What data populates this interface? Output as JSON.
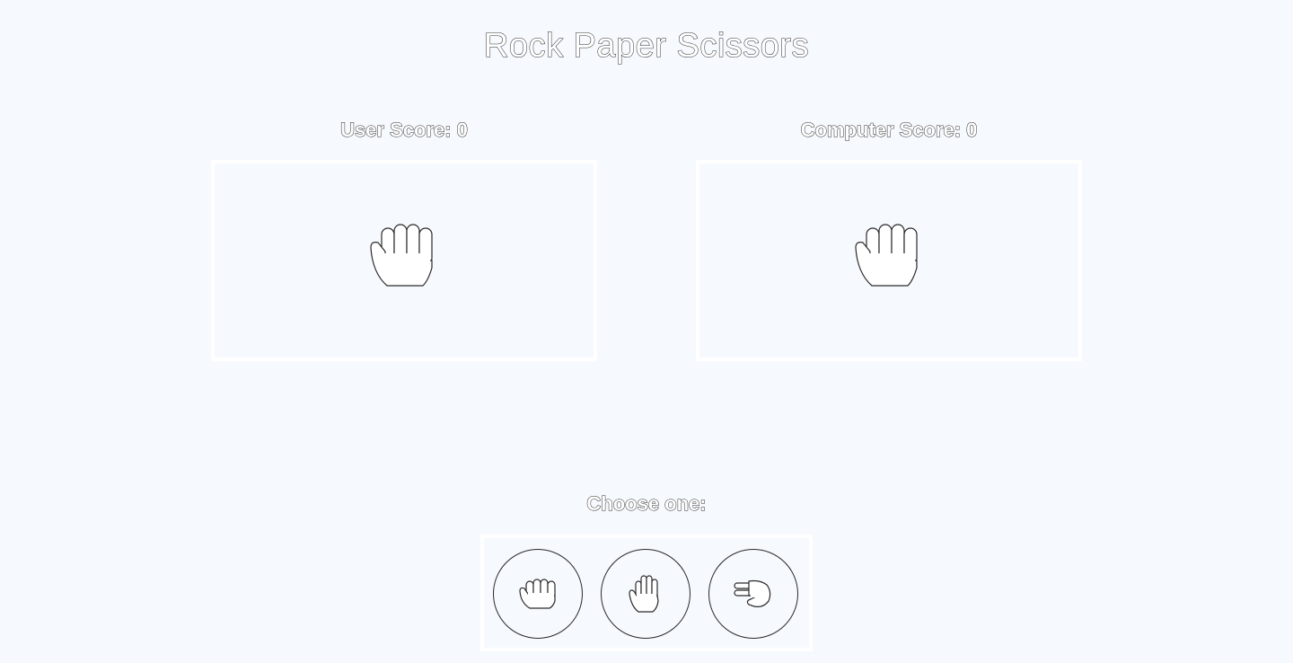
{
  "title": "Rock Paper Scissors",
  "user": {
    "score_label": "User Score: 0",
    "hand_icon": "fist-hand-icon"
  },
  "computer": {
    "score_label": "Computer Score: 0",
    "hand_icon": "fist-hand-icon"
  },
  "choose_label": "Choose one:",
  "choices": [
    {
      "name": "rock",
      "icon": "rock-hand-icon"
    },
    {
      "name": "paper",
      "icon": "paper-hand-icon"
    },
    {
      "name": "scissors",
      "icon": "scissors-hand-icon"
    }
  ],
  "colors": {
    "background": "#f6f9fd",
    "panel_border": "#ffffff",
    "outline": "#2a2a2a"
  }
}
